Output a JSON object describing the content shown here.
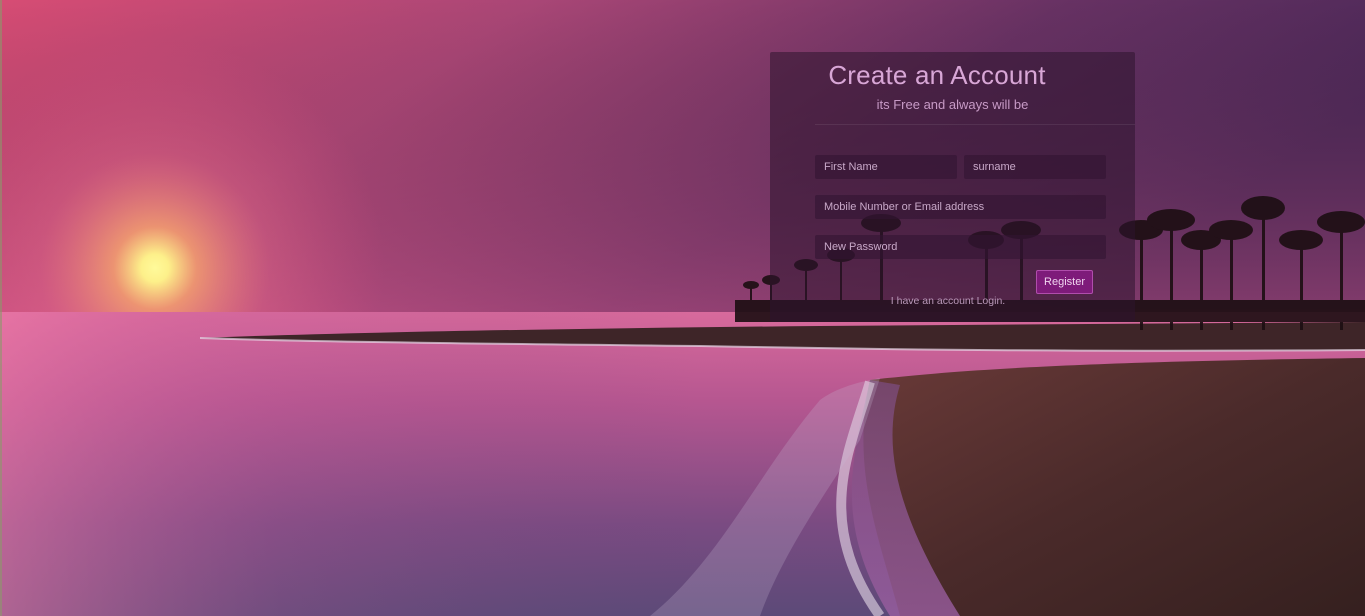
{
  "form": {
    "title": "Create an Account",
    "subtitle": "its Free and always will be",
    "first_name_placeholder": "First Name",
    "surname_placeholder": "surname",
    "contact_placeholder": "Mobile Number or Email address",
    "password_placeholder": "New Password",
    "register_label": "Register",
    "login_link": "I have an account Login."
  },
  "colors": {
    "panel_bg": "#2d142d",
    "title_text": "#d8a6d6",
    "register_button": "#7e1b7a"
  },
  "background": {
    "scene": "tropical beach sunset",
    "icon": "sun-icon"
  }
}
